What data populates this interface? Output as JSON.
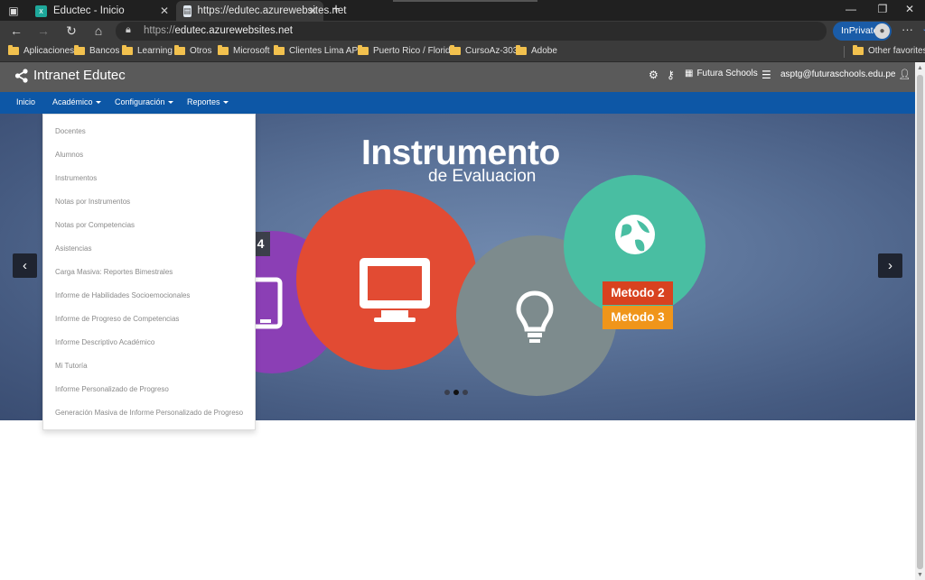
{
  "browser": {
    "tabs": [
      {
        "title": "Eductec - Inicio"
      },
      {
        "title": "https://edutec.azurewebsites.net"
      }
    ],
    "url_prefix": "https://",
    "url_host": "edutec.azurewebsites.net",
    "inprivate_label": "InPrivate",
    "bookmarks": [
      "Aplicaciones",
      "Bancos",
      "Learning",
      "Otros",
      "Microsoft",
      "Clientes Lima APP",
      "Puerto Rico / Florida",
      "CursoAz-303",
      "Adobe"
    ],
    "other_favorites": "Other favorites"
  },
  "app": {
    "brand": "Intranet Edutec",
    "school": "Futura Schools",
    "user_email": "asptg@futuraschools.edu.pe"
  },
  "menu": {
    "inicio": "Inicio",
    "academico": "Académico",
    "configuracion": "Configuración",
    "reportes": "Reportes"
  },
  "dropdown_items": [
    "Docentes",
    "Alumnos",
    "Instrumentos",
    "Notas por Instrumentos",
    "Notas por Competencias",
    "Asistencias",
    "Carga Masiva: Reportes Bimestrales",
    "Informe de Habilidades Socioemocionales",
    "Informe de Progreso de Competencias",
    "Informe Descriptivo Académico",
    "Mi Tutoría",
    "Informe Personalizado de Progreso",
    "Generación Masiva de Informe Personalizado de Progreso"
  ],
  "slide": {
    "title": "Instrumento",
    "subtitle": "de Evaluacion",
    "badge_number": "4",
    "metodo2": "Metodo 2",
    "metodo3": "Metodo 3",
    "active_dot": 2,
    "dot_count": 3
  },
  "colors": {
    "menubar": "#0d57a6",
    "appbar": "#5a5a5a",
    "purple": "#8b3fb5",
    "red": "#e24b33",
    "gray": "#7d8b8d",
    "teal": "#49bea2",
    "metodo2": "#d8421f",
    "metodo3": "#f0951a"
  }
}
